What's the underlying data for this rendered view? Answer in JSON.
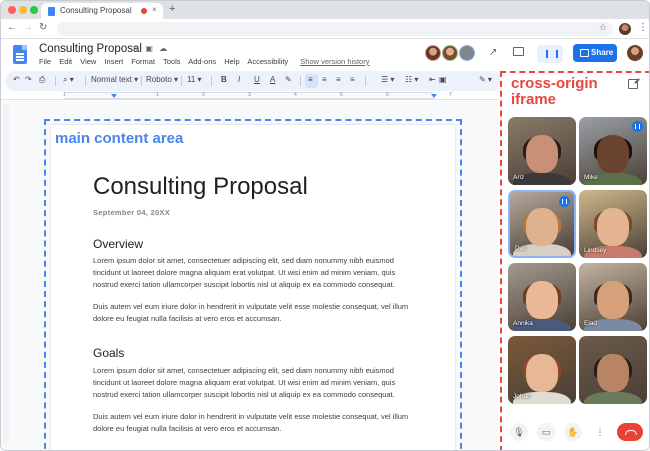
{
  "browser": {
    "tab_title": "Consulting Proposal",
    "new_tab": "+",
    "tab_close": "×",
    "back": "←",
    "forward": "→",
    "reload": "↻",
    "star": "☆",
    "menu": "⋮"
  },
  "docs": {
    "title": "Consulting Proposal",
    "title_icons": "☆ ▣ ☁",
    "menus": [
      "File",
      "Edit",
      "View",
      "Insert",
      "Format",
      "Tools",
      "Add-ons",
      "Help",
      "Accessibility"
    ],
    "version_history": "Show version history",
    "share_label": "Share",
    "trend": "↗"
  },
  "toolbar": {
    "undo": "↶",
    "redo": "↷",
    "print": "⎙",
    "paint": "⌖",
    "zoom": "⌕ ▾",
    "style": "Normal text ▾",
    "font": "Roboto ▾",
    "size": "11 ▾",
    "bold": "B",
    "italic": "I",
    "underline": "U",
    "text_color": "A",
    "highlight": "✎",
    "align_left": "≡",
    "align_center": "≡",
    "align_right": "≡",
    "align_justify": "≡",
    "bullets": "☰ ▾",
    "numbered": "☷ ▾",
    "indent": "⇤",
    "image": "▣",
    "edit_mode": "✎ ▾"
  },
  "ruler": {
    "numbers": [
      "1",
      "1",
      "2",
      "3",
      "4",
      "5",
      "6",
      "7"
    ]
  },
  "main_label": "main content area",
  "document": {
    "heading": "Consulting Proposal",
    "date": "September 04, 20XX",
    "section1_title": "Overview",
    "section1_p1": "Lorem ipsum dolor sit amet, consectetuer adipiscing elit, sed diam nonummy nibh euismod tincidunt ut laoreet dolore magna aliquam erat volutpat. Ut wisi enim ad minim veniam, quis nostrud exerci tation ullamcorper suscipit lobortis nisl ut aliquip ex ea commodo consequat.",
    "section1_p2": "Duis autem vel eum iriure dolor in hendrerit in vulputate velit esse molestie consequat, vel illum dolore eu feugiat nulla facilisis at vero eros et accumsan.",
    "section2_title": "Goals",
    "section2_p1": "Lorem ipsum dolor sit amet, consectetuer adipiscing elit, sed diam nonummy nibh euismod tincidunt ut laoreet dolore magna aliquam erat volutpat. Ut wisi enim ad minim veniam, quis nostrud exerci tation ullamcorper suscipit lobortis nisl ut aliquip ex ea commodo consequat.",
    "section2_p2": "Duis autem vel eum iriure dolor in hendrerit in vulputate velit esse molestie consequat, vel illum dolore eu feugiat nulla facilisis at vero eros et accumsan."
  },
  "side_panel": {
    "label": "cross-origin iframe",
    "participants": [
      {
        "name": "Ariz",
        "speaking": false,
        "skin": "#c99075",
        "hair": "#2b1d16",
        "shirt": "#3a3a3a",
        "bg": "#8a7a6a"
      },
      {
        "name": "Mike",
        "speaking": false,
        "skin": "#6b4430",
        "hair": "#1a120d",
        "shirt": "#5b6f4a",
        "bg": "#9aa0a6"
      },
      {
        "name": "Dan",
        "speaking": true,
        "skin": "#e0b18f",
        "hair": "#b07a3a",
        "shirt": "#d6cfc3",
        "bg": "#b6a79a"
      },
      {
        "name": "Lindsey",
        "speaking": false,
        "skin": "#e3b48f",
        "hair": "#7a4a2a",
        "shirt": "#c97a6a",
        "bg": "#cfb88a"
      },
      {
        "name": "Annika",
        "speaking": false,
        "skin": "#eab897",
        "hair": "#6a3f22",
        "shirt": "#4a5a7a",
        "bg": "#a39b8f"
      },
      {
        "name": "Elad",
        "speaking": false,
        "skin": "#d6a07a",
        "hair": "#3a2a1f",
        "shirt": "#7a8aa0",
        "bg": "#c4b4a0"
      },
      {
        "name": "Johan",
        "speaking": false,
        "skin": "#e8b796",
        "hair": "#8a4a2a",
        "shirt": "#e0dcd4",
        "bg": "#7a5a3a"
      },
      {
        "name": "",
        "speaking": false,
        "skin": "#b98463",
        "hair": "#2a1f18",
        "shirt": "#6a7a5a",
        "bg": "#6a5a4a"
      }
    ],
    "controls": {
      "mic": "🎙",
      "camera": "▭",
      "hand": "✋",
      "more": "⋮"
    }
  },
  "colors": {
    "main_area": "#4a86e8",
    "iframe_border": "#e8453c",
    "share": "#1a73e8",
    "end_call": "#ea4335"
  }
}
